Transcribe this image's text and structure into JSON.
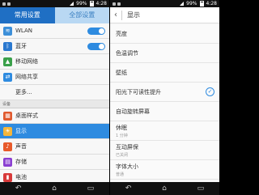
{
  "left_status": {
    "time": "4:28",
    "battery": "99%"
  },
  "right_status": {
    "time": "4:28",
    "battery": "99%"
  },
  "tabs": [
    {
      "label": "常用设置",
      "active": true
    },
    {
      "label": "全部设置",
      "active": false
    }
  ],
  "left_list": {
    "wlan": {
      "label": "WLAN",
      "icon": "wifi-icon",
      "toggle_on": true
    },
    "bluetooth": {
      "label": "蓝牙",
      "icon": "bluetooth-icon",
      "toggle_on": true
    },
    "mobile": {
      "label": "移动网络",
      "icon": "mobile-network-icon"
    },
    "tethering": {
      "label": "网络共享",
      "icon": "tethering-icon"
    },
    "more": {
      "label": "更多..."
    },
    "section": {
      "label": "设备"
    },
    "desktop_style": {
      "label": "桌面样式",
      "icon": "desktop-style-icon"
    },
    "display": {
      "label": "显示",
      "icon": "display-icon",
      "selected": true
    },
    "sound": {
      "label": "声音",
      "icon": "sound-icon"
    },
    "notify": {
      "label": "存储",
      "icon": "storage-icon"
    },
    "power": {
      "label": "电池",
      "icon": "battery-icon"
    }
  },
  "header": {
    "title": "显示",
    "back_icon": "back-arrow-icon"
  },
  "right_list": [
    {
      "label": "亮度",
      "sub": ""
    },
    {
      "label": "色温调节",
      "sub": ""
    },
    {
      "label": "壁纸",
      "sub": ""
    },
    {
      "label": "阳光下可读性提升",
      "sub": "",
      "checked": true
    },
    {
      "label": "自动旋转屏幕",
      "sub": ""
    },
    {
      "label": "休眠",
      "sub": "1 分钟"
    },
    {
      "label": "互动屏保",
      "sub": "已关闭"
    },
    {
      "label": "字体大小",
      "sub": "普通"
    }
  ],
  "nav": {
    "back": "back-icon",
    "home": "home-icon",
    "recent": "recent-apps-icon"
  },
  "colors": {
    "accent": "#2e8be0"
  }
}
